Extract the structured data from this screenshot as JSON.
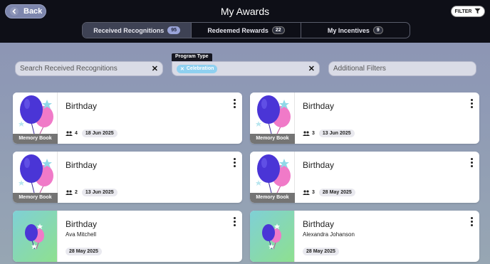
{
  "header": {
    "back_label": "Back",
    "title": "My Awards",
    "filter_label": "FILTER"
  },
  "tabs": [
    {
      "label": "Received Recognitions",
      "count": "95",
      "active": true
    },
    {
      "label": "Redeemed Rewards",
      "count": "22",
      "active": false
    },
    {
      "label": "My Incentives",
      "count": "9",
      "active": false
    }
  ],
  "filters": {
    "search_placeholder": "Search Received Recognitions",
    "program_type_label": "Program Type",
    "program_type_chip": "Celebration",
    "additional_filters_label": "Additional Filters"
  },
  "cards": [
    {
      "title": "Birthday",
      "badge": "Memory Book",
      "people": "4",
      "date": "18 Jun 2025",
      "image": "balloons-icon"
    },
    {
      "title": "Birthday",
      "badge": "Memory Book",
      "people": "3",
      "date": "13 Jun 2025",
      "image": "balloons-icon"
    },
    {
      "title": "Birthday",
      "badge": "Memory Book",
      "people": "2",
      "date": "13 Jun 2025",
      "image": "balloons-icon"
    },
    {
      "title": "Birthday",
      "badge": "Memory Book",
      "people": "3",
      "date": "28 May 2025",
      "image": "balloons-icon"
    },
    {
      "title": "Birthday",
      "subtitle": "Ava Mitchell",
      "date": "28 May 2025",
      "image": "balloons-small-icon"
    },
    {
      "title": "Birthday",
      "subtitle": "Alexandra Johanson",
      "date": "28 May 2025",
      "image": "balloons-small-icon"
    }
  ],
  "colors": {
    "topbar": "#0e0f17",
    "active_tab_badge": "#9aa4d8",
    "chip": "#8fd0f0",
    "balloon_purple": "#4a35d6",
    "balloon_pink": "#f07ac8"
  }
}
